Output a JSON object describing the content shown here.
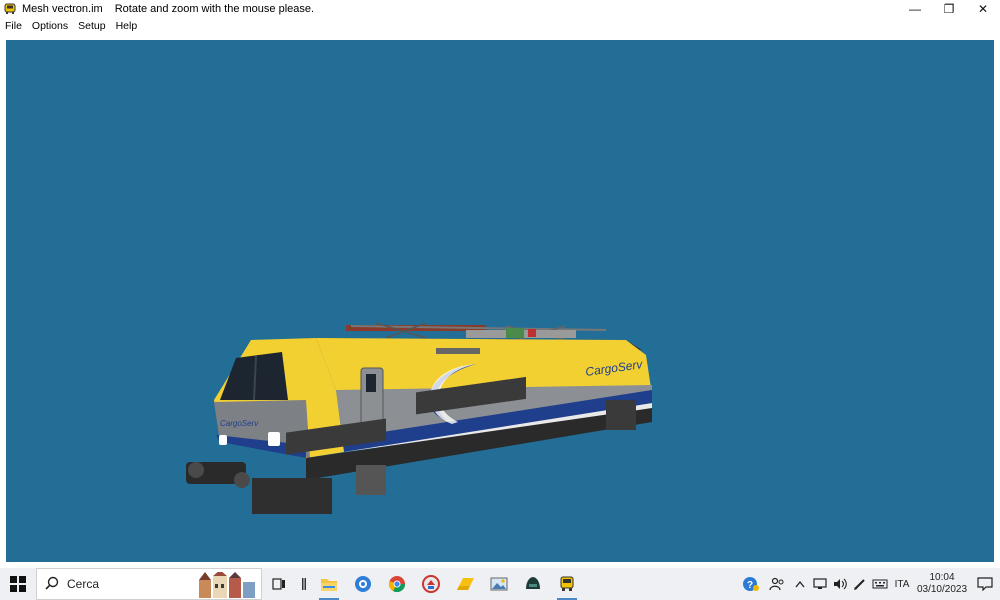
{
  "window": {
    "title": "Mesh vectron.im",
    "hint": "Rotate and zoom with the mouse please.",
    "controls": {
      "minimize": "—",
      "restore": "❐",
      "close": "✕"
    }
  },
  "menu": [
    "File",
    "Options",
    "Setup",
    "Help"
  ],
  "viewport": {
    "background": "#236e96",
    "model": {
      "livery_text_side": "CargoServ",
      "livery_text_front": "CargoServ"
    }
  },
  "taskbar": {
    "search_placeholder": "Cerca",
    "pinned": [
      "task-view-icon",
      "divider-icon",
      "file-explorer-icon",
      "settings-app-icon",
      "chrome-icon",
      "app-red-icon",
      "folder-yellow-icon",
      "photos-icon",
      "helmet-app-icon",
      "train-app-icon"
    ],
    "tray": {
      "language": "ITA",
      "time": "10:04",
      "date": "03/10/2023"
    }
  }
}
